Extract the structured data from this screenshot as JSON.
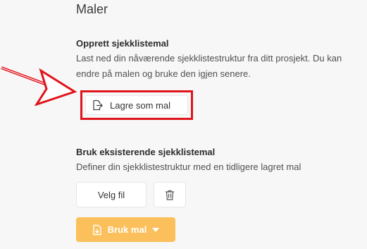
{
  "section": {
    "title": "Maler"
  },
  "create_template": {
    "heading": "Opprett sjekklistemal",
    "description": "Last ned din nåværende sjekklistestruktur fra ditt prosjekt. Du kan endre på malen og bruke den igjen senere.",
    "save_button_label": "Lagre som mal",
    "save_icon": "export-file-icon"
  },
  "use_template": {
    "heading": "Bruk eksisterende sjekklistemal",
    "description": "Definer din sjekklistestruktur med en tidligere lagret mal",
    "choose_file_label": "Velg fil",
    "delete_icon": "trash-icon",
    "use_button_label": "Bruk mal",
    "use_button_icon": "import-file-icon",
    "use_button_dropdown_icon": "caret-down-icon"
  },
  "annotation": {
    "arrow_color": "#e0141b",
    "highlight_color": "#e0141b"
  },
  "colors": {
    "accent": "#fbc05c",
    "background": "#f7f7f7"
  }
}
